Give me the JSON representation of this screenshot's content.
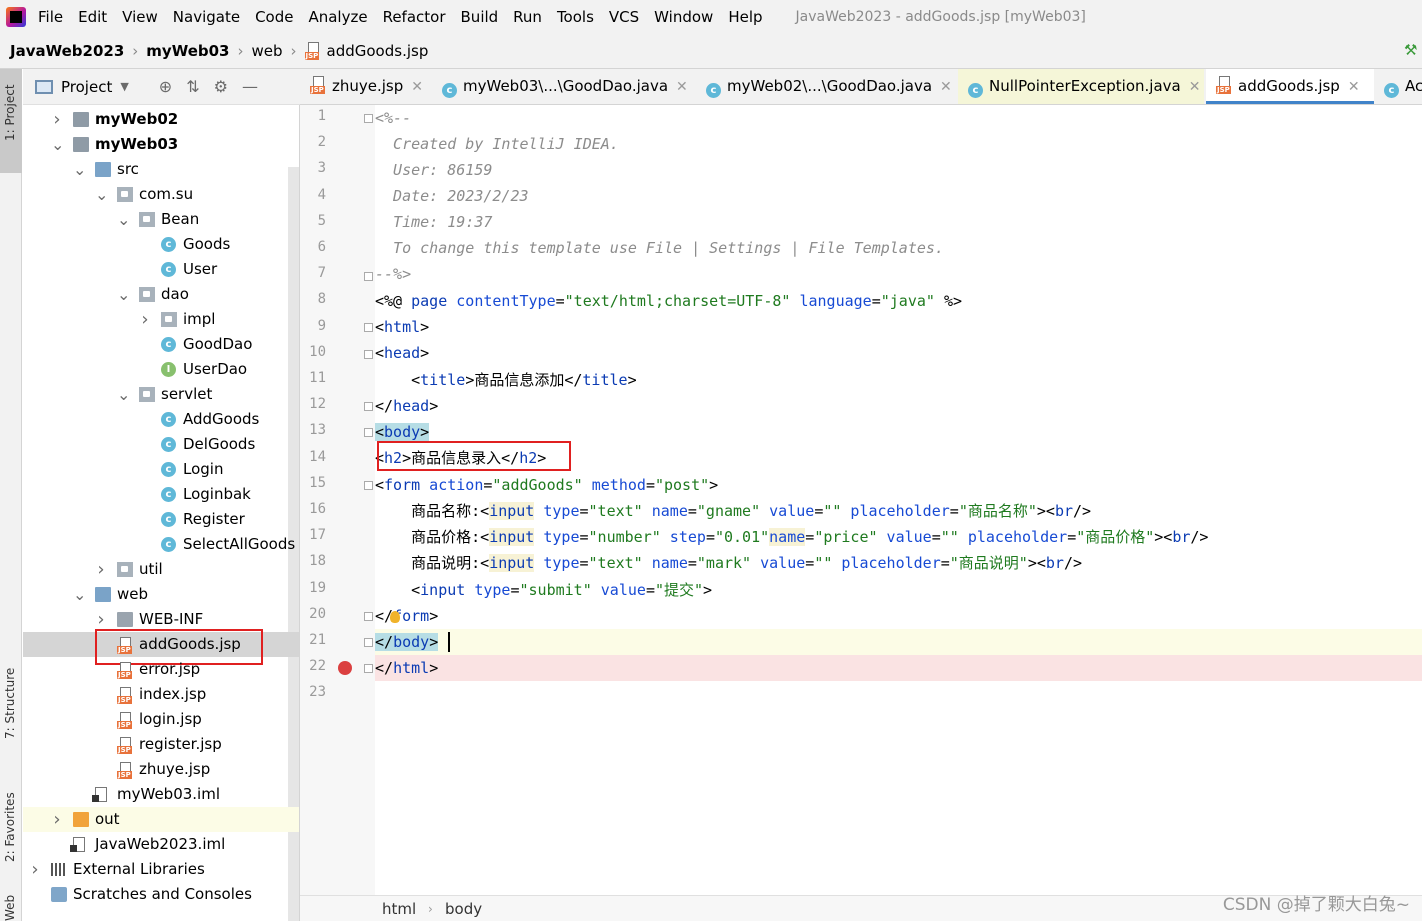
{
  "menu": {
    "items": [
      "File",
      "Edit",
      "View",
      "Navigate",
      "Code",
      "Analyze",
      "Refactor",
      "Build",
      "Run",
      "Tools",
      "VCS",
      "Window",
      "Help"
    ],
    "window_title": "JavaWeb2023 - addGoods.jsp [myWeb03]"
  },
  "nav": {
    "project": "JavaWeb2023",
    "module": "myWeb03",
    "folder": "web",
    "file": "addGoods.jsp"
  },
  "stripe": {
    "project": "1: Project",
    "structure": "7: Structure",
    "favorites": "2: Favorites",
    "web": "Web"
  },
  "project_panel": {
    "title": "Project"
  },
  "tree": [
    {
      "label": "myWeb02",
      "icon": "folder-module-icon",
      "arrow": "right",
      "bold": true
    },
    {
      "label": "myWeb03",
      "icon": "folder-module-icon",
      "arrow": "down",
      "bold": true
    },
    {
      "label": "src",
      "icon": "folder-src-icon",
      "arrow": "down"
    },
    {
      "label": "com.su",
      "icon": "package-icon",
      "arrow": "down"
    },
    {
      "label": "Bean",
      "icon": "package-icon",
      "arrow": "down"
    },
    {
      "label": "Goods",
      "icon": "class-icon"
    },
    {
      "label": "User",
      "icon": "class-icon"
    },
    {
      "label": "dao",
      "icon": "package-icon",
      "arrow": "down"
    },
    {
      "label": "impl",
      "icon": "package-icon",
      "arrow": "right"
    },
    {
      "label": "GoodDao",
      "icon": "class-icon"
    },
    {
      "label": "UserDao",
      "icon": "interface-icon"
    },
    {
      "label": "servlet",
      "icon": "package-icon",
      "arrow": "down"
    },
    {
      "label": "AddGoods",
      "icon": "class-icon"
    },
    {
      "label": "DelGoods",
      "icon": "class-icon"
    },
    {
      "label": "Login",
      "icon": "class-icon"
    },
    {
      "label": "Loginbak",
      "icon": "class-icon"
    },
    {
      "label": "Register",
      "icon": "class-icon"
    },
    {
      "label": "SelectAllGoods",
      "icon": "class-icon"
    },
    {
      "label": "util",
      "icon": "package-icon",
      "arrow": "right"
    },
    {
      "label": "web",
      "icon": "folder-web-icon",
      "arrow": "down"
    },
    {
      "label": "WEB-INF",
      "icon": "folder-icon",
      "arrow": "right"
    },
    {
      "label": "addGoods.jsp",
      "icon": "jsp-file-icon",
      "selected": true
    },
    {
      "label": "error.jsp",
      "icon": "jsp-file-icon"
    },
    {
      "label": "index.jsp",
      "icon": "jsp-file-icon"
    },
    {
      "label": "login.jsp",
      "icon": "jsp-file-icon"
    },
    {
      "label": "register.jsp",
      "icon": "jsp-file-icon"
    },
    {
      "label": "zhuye.jsp",
      "icon": "jsp-file-icon"
    },
    {
      "label": "myWeb03.iml",
      "icon": "iml-file-icon"
    },
    {
      "label": "out",
      "icon": "folder-excluded-icon",
      "arrow": "right"
    },
    {
      "label": "JavaWeb2023.iml",
      "icon": "iml-file-icon"
    },
    {
      "label": "External Libraries",
      "icon": "library-icon",
      "arrow": "right"
    },
    {
      "label": "Scratches and Consoles",
      "icon": "scratches-icon"
    }
  ],
  "tabs": [
    {
      "label": "zhuye.jsp",
      "icon": "jsp-file-icon"
    },
    {
      "label": "myWeb03\\...\\GoodDao.java",
      "icon": "class-icon"
    },
    {
      "label": "myWeb02\\...\\GoodDao.java",
      "icon": "class-icon"
    },
    {
      "label": "NullPointerException.java",
      "icon": "class-icon"
    },
    {
      "label": "addGoods.jsp",
      "icon": "jsp-file-icon",
      "active": true
    },
    {
      "label": "Ac",
      "icon": "class-icon"
    }
  ],
  "code": {
    "line_numbers": [
      "1",
      "2",
      "3",
      "4",
      "5",
      "6",
      "7",
      "8",
      "9",
      "10",
      "11",
      "12",
      "13",
      "14",
      "15",
      "16",
      "17",
      "18",
      "19",
      "20",
      "21",
      "22",
      "23"
    ],
    "l1": "<%--",
    "l2": "  Created by IntelliJ IDEA.",
    "l3": "  User: 86159",
    "l4": "  Date: 2023/2/23",
    "l5": "  Time: 19:37",
    "l6": "  To change this template use File | Settings | File Templates.",
    "l7": "--%>",
    "l8a": "<%@ ",
    "l8b": "page ",
    "l8c": "contentType",
    "l8d": "=",
    "l8e": "\"text/html;charset=UTF-8\"",
    "l8f": " language",
    "l8g": "=",
    "l8h": "\"java\"",
    "l8i": " %>",
    "l9a": "<",
    "l9b": "html",
    "l9c": ">",
    "l10a": "<",
    "l10b": "head",
    "l10c": ">",
    "l11a": "    <",
    "l11b": "title",
    "l11c": ">商品信息添加</",
    "l11d": "title",
    "l11e": ">",
    "l12a": "</",
    "l12b": "head",
    "l12c": ">",
    "l13a": "<",
    "l13b": "body",
    "l13c": ">",
    "l14a": "<",
    "l14b": "h2",
    "l14c": ">商品信息录入</",
    "l14d": "h2",
    "l14e": ">",
    "l15a": "<",
    "l15b": "form",
    "l15c": " action",
    "l15d": "=",
    "l15e": "\"addGoods\"",
    "l15f": " method",
    "l15g": "=",
    "l15h": "\"post\"",
    "l15i": ">",
    "l16a": "    商品名称:<",
    "l16b": "input",
    "l16c": " type",
    "l16d": "=",
    "l16e": "\"text\"",
    "l16f": " name",
    "l16g": "=",
    "l16h": "\"gname\"",
    "l16i": " value",
    "l16j": "=",
    "l16k": "\"\"",
    "l16l": " placeholder",
    "l16m": "=",
    "l16n": "\"商品名称\"",
    "l16o": "><",
    "l16p": "br",
    "l16q": "/>",
    "l17a": "    商品价格:<",
    "l17b": "input",
    "l17c": " type",
    "l17d": "=",
    "l17e": "\"number\"",
    "l17f": " step",
    "l17g": "=",
    "l17h": "\"0.01\"",
    "l17i": "name",
    "l17j": "=",
    "l17k": "\"price\"",
    "l17l": " value",
    "l17m": "=",
    "l17n": "\"\"",
    "l17o": " placeholder",
    "l17p": "=",
    "l17q": "\"商品价格\"",
    "l17r": "><",
    "l17s": "br",
    "l17t": "/>",
    "l18a": "    商品说明:<",
    "l18b": "input",
    "l18c": " type",
    "l18d": "=",
    "l18e": "\"text\"",
    "l18f": " name",
    "l18g": "=",
    "l18h": "\"mark\"",
    "l18i": " value",
    "l18j": "=",
    "l18k": "\"\"",
    "l18l": " placeholder",
    "l18m": "=",
    "l18n": "\"商品说明\"",
    "l18o": "><",
    "l18p": "br",
    "l18q": "/>",
    "l19a": "    <",
    "l19b": "input",
    "l19c": " type",
    "l19d": "=",
    "l19e": "\"submit\"",
    "l19f": " value",
    "l19g": "=",
    "l19h": "\"提交\"",
    "l19i": ">",
    "l20a": "</",
    "l20b": "form",
    "l20c": ">",
    "l21a": "</",
    "l21b": "body",
    "l21c": ">",
    "l22a": "</",
    "l22b": "html",
    "l22c": ">"
  },
  "status": {
    "crumb1": "html",
    "crumb2": "body"
  },
  "watermark": "CSDN @掉了颗大白兔~",
  "colors": {
    "accent": "#4083c9",
    "highlight_box": "#e02020",
    "tag": "#0b3bb3",
    "string": "#1f7a1f",
    "comment": "#8c8c8c"
  }
}
